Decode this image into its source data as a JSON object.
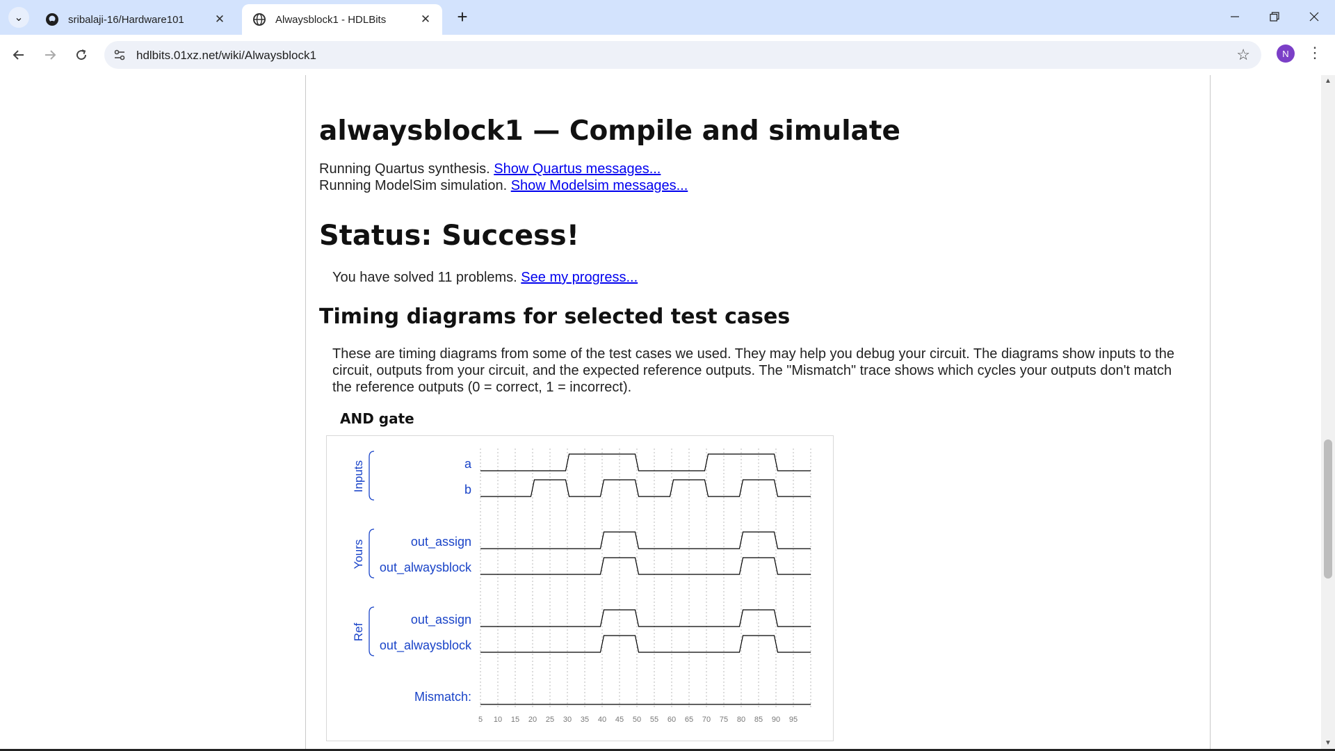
{
  "browser": {
    "tabs": [
      {
        "title": "sribalaji-16/Hardware101",
        "icon": "github-icon",
        "active": false
      },
      {
        "title": "Alwaysblock1 - HDLBits",
        "icon": "globe-icon",
        "active": true
      }
    ],
    "url": "hdlbits.01xz.net/wiki/Alwaysblock1",
    "profile_initial": "N"
  },
  "page": {
    "title": "alwaysblock1 — Compile and simulate",
    "quartus_text": "Running Quartus synthesis.",
    "quartus_link": "Show Quartus messages...",
    "modelsim_text": "Running ModelSim simulation.",
    "modelsim_link": "Show Modelsim messages...",
    "status": "Status: Success!",
    "solved_text": "You have solved 11 problems.",
    "progress_link": "See my progress...",
    "timing_heading": "Timing diagrams for selected test cases",
    "timing_desc": "These are timing diagrams from some of the test cases we used. They may help you debug your circuit. The diagrams show inputs to the circuit, outputs from your circuit, and the expected reference outputs. The \"Mismatch\" trace shows which cycles your outputs don't match the reference outputs (0 = correct, 1 = incorrect).",
    "case_title": "AND gate"
  },
  "diagram": {
    "groups": [
      {
        "label": "Inputs",
        "signals": [
          "a",
          "b"
        ]
      },
      {
        "label": "Yours",
        "signals": [
          "out_assign",
          "out_alwaysblock"
        ]
      },
      {
        "label": "Ref",
        "signals": [
          "out_assign",
          "out_alwaysblock"
        ]
      }
    ],
    "mismatch_label": "Mismatch:",
    "time_ticks": [
      5,
      10,
      15,
      20,
      25,
      30,
      35,
      40,
      45,
      50,
      55,
      60,
      65,
      70,
      75,
      80,
      85,
      90,
      95
    ],
    "signal_values": {
      "a": [
        0,
        0,
        0,
        0,
        0,
        1,
        1,
        1,
        1,
        0,
        0,
        0,
        0,
        1,
        1,
        1,
        1,
        0,
        0
      ],
      "b": [
        0,
        0,
        0,
        1,
        1,
        0,
        0,
        1,
        1,
        0,
        0,
        1,
        1,
        0,
        0,
        1,
        1,
        0,
        0
      ],
      "yours_out_assign": [
        0,
        0,
        0,
        0,
        0,
        0,
        0,
        1,
        1,
        0,
        0,
        0,
        0,
        0,
        0,
        1,
        1,
        0,
        0
      ],
      "yours_out_alwaysblock": [
        0,
        0,
        0,
        0,
        0,
        0,
        0,
        1,
        1,
        0,
        0,
        0,
        0,
        0,
        0,
        1,
        1,
        0,
        0
      ],
      "ref_out_assign": [
        0,
        0,
        0,
        0,
        0,
        0,
        0,
        1,
        1,
        0,
        0,
        0,
        0,
        0,
        0,
        1,
        1,
        0,
        0
      ],
      "ref_out_alwaysblock": [
        0,
        0,
        0,
        0,
        0,
        0,
        0,
        1,
        1,
        0,
        0,
        0,
        0,
        0,
        0,
        1,
        1,
        0,
        0
      ],
      "mismatch": [
        0,
        0,
        0,
        0,
        0,
        0,
        0,
        0,
        0,
        0,
        0,
        0,
        0,
        0,
        0,
        0,
        0,
        0,
        0
      ]
    },
    "colors": {
      "label": "#1a44c8",
      "trace": "#000000",
      "grid": "#b8b8b8",
      "tick": "#777777"
    }
  }
}
